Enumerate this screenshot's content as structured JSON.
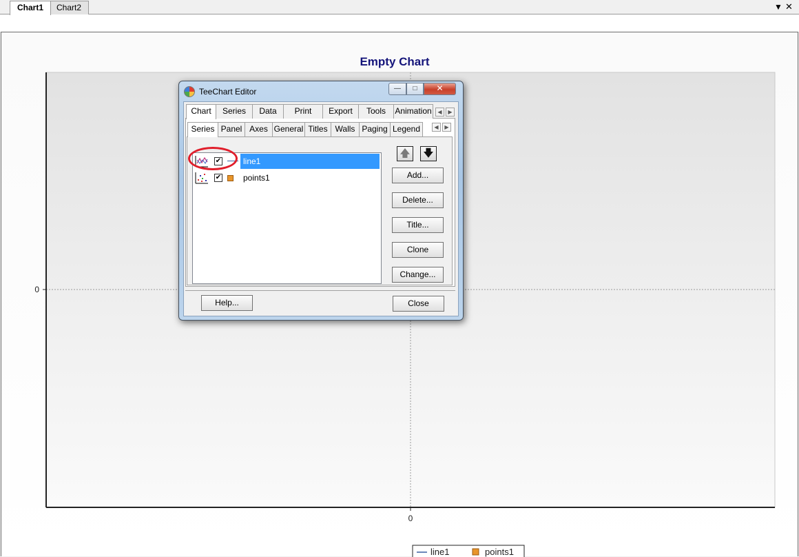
{
  "tabstrip": {
    "tabs": [
      {
        "label": "Chart1",
        "active": true
      },
      {
        "label": "Chart2",
        "active": false
      }
    ],
    "menu_glyph": "▼",
    "close_glyph": "✕"
  },
  "chart_data": {
    "type": "line",
    "title": "Empty Chart",
    "x_tick_labels": [
      "0"
    ],
    "y_tick_labels": [
      "0"
    ],
    "series": [
      {
        "name": "line1",
        "type": "line",
        "values": []
      },
      {
        "name": "points1",
        "type": "points",
        "values": []
      }
    ],
    "grid": true,
    "legend_position": "bottom",
    "colors": {
      "title": "#14147a",
      "line1": "#3b5fa3",
      "points1": "#e8952b"
    }
  },
  "dialog": {
    "title": "TeeChart Editor",
    "caption_buttons": {
      "min": "—",
      "max": "□",
      "close": "✕"
    },
    "tabs": [
      "Chart",
      "Series",
      "Data",
      "Print",
      "Export",
      "Tools",
      "Animation"
    ],
    "subtabs": [
      "Series",
      "Panel",
      "Axes",
      "General",
      "Titles",
      "Walls",
      "Paging",
      "Legend"
    ],
    "series_list": [
      {
        "name": "line1",
        "checked": true,
        "selected": true,
        "icon": "line-gallery-icon"
      },
      {
        "name": "points1",
        "checked": true,
        "selected": false,
        "icon": "points-gallery-icon"
      }
    ],
    "check_glyph": "✔",
    "arrow_up": "🡅",
    "arrow_down": "🡇",
    "buttons": {
      "add": "Add...",
      "delete": "Delete...",
      "title": "Title...",
      "clone": "Clone",
      "change": "Change...",
      "help": "Help...",
      "close": "Close"
    },
    "scroll_left": "◀",
    "scroll_right": "▶"
  }
}
